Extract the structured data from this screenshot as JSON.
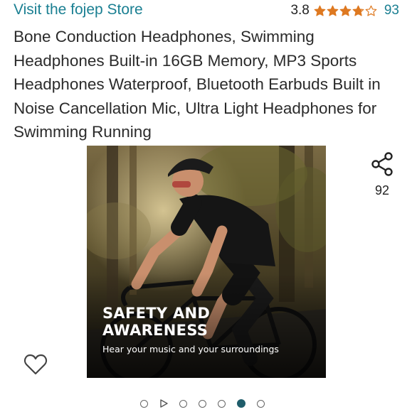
{
  "store": {
    "link_text": "Visit the fojep Store",
    "color": "#1a7f92"
  },
  "rating": {
    "value": "3.8",
    "stars_filled": 3.8,
    "stars_total": 5,
    "count": "93",
    "star_color": "#de7921"
  },
  "product": {
    "title": "Bone Conduction Headphones, Swimming Headphones Built-in 16GB Memory, MP3 Sports Headphones Waterproof, Bluetooth Earbuds Built in Noise Cancellation Mic, Ultra Light Headphones for Swimming Running"
  },
  "image": {
    "headline": "SAFETY AND AWARENESS",
    "subline": "Hear your music and your surroundings"
  },
  "share": {
    "icon": "share-icon",
    "count": "92"
  },
  "wishlist": {
    "icon": "heart-outline-icon"
  },
  "carousel": {
    "items": [
      "dot",
      "play",
      "dot",
      "dot",
      "dot",
      "dot",
      "dot"
    ],
    "active_index": 5,
    "active_color": "#1f5d6b"
  }
}
